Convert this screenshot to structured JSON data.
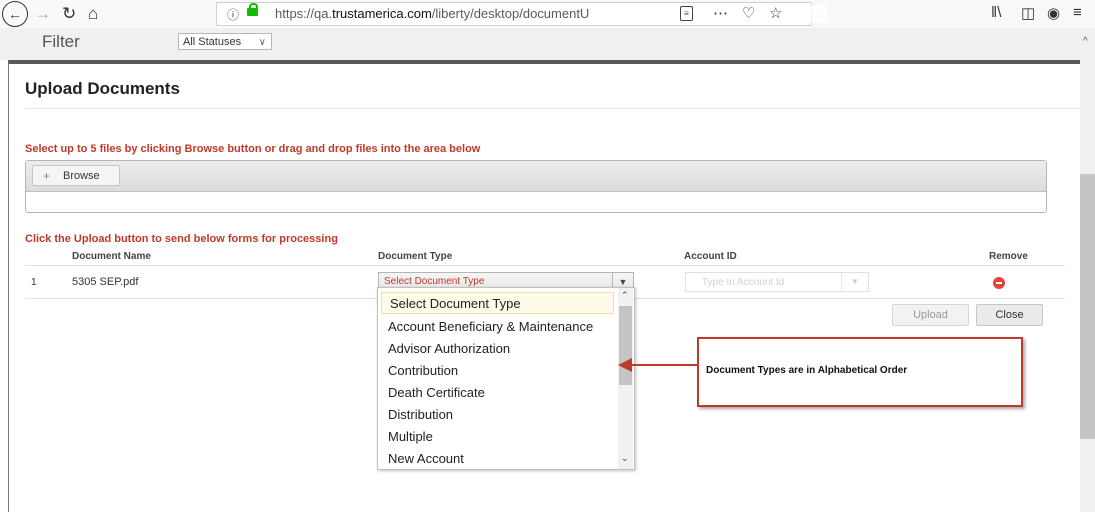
{
  "browser": {
    "url_prefix": "https://qa.",
    "url_domain": "trustamerica.com",
    "url_path": "/liberty/desktop/documentU",
    "icons": [
      "back-icon",
      "forward-icon",
      "reload-icon",
      "home-icon",
      "info-icon",
      "lock-icon",
      "reader-icon",
      "more-icon",
      "pocket-icon",
      "bookmark-star-icon",
      "library-icon",
      "sidebar-icon",
      "account-icon",
      "menu-icon"
    ]
  },
  "page": {
    "filter_label": "Filter",
    "status_select": "All Statuses"
  },
  "modal": {
    "title": "Upload Documents",
    "instruction_select": "Select up to 5 files by clicking Browse button or drag and drop files into the area below",
    "browse_label": "Browse",
    "instruction_upload": "Click the Upload button to send below forms for processing",
    "columns": {
      "document_name": "Document Name",
      "document_type": "Document Type",
      "account_id": "Account ID",
      "remove": "Remove"
    },
    "rows": [
      {
        "index": "1",
        "document_name": "5305 SEP.pdf",
        "document_type": "Select Document Type",
        "account_placeholder": "Type In Account Id"
      }
    ],
    "upload_label": "Upload",
    "close_label": "Close"
  },
  "dropdown": {
    "options": [
      "Select Document Type",
      "Account Beneficiary & Maintenance",
      "Advisor Authorization",
      "Contribution",
      "Death Certificate",
      "Distribution",
      "Multiple",
      "New Account"
    ],
    "selected": "Select Document Type"
  },
  "annotation": {
    "text": "Document Types are in Alphabetical Order",
    "color": "#c0392b"
  }
}
